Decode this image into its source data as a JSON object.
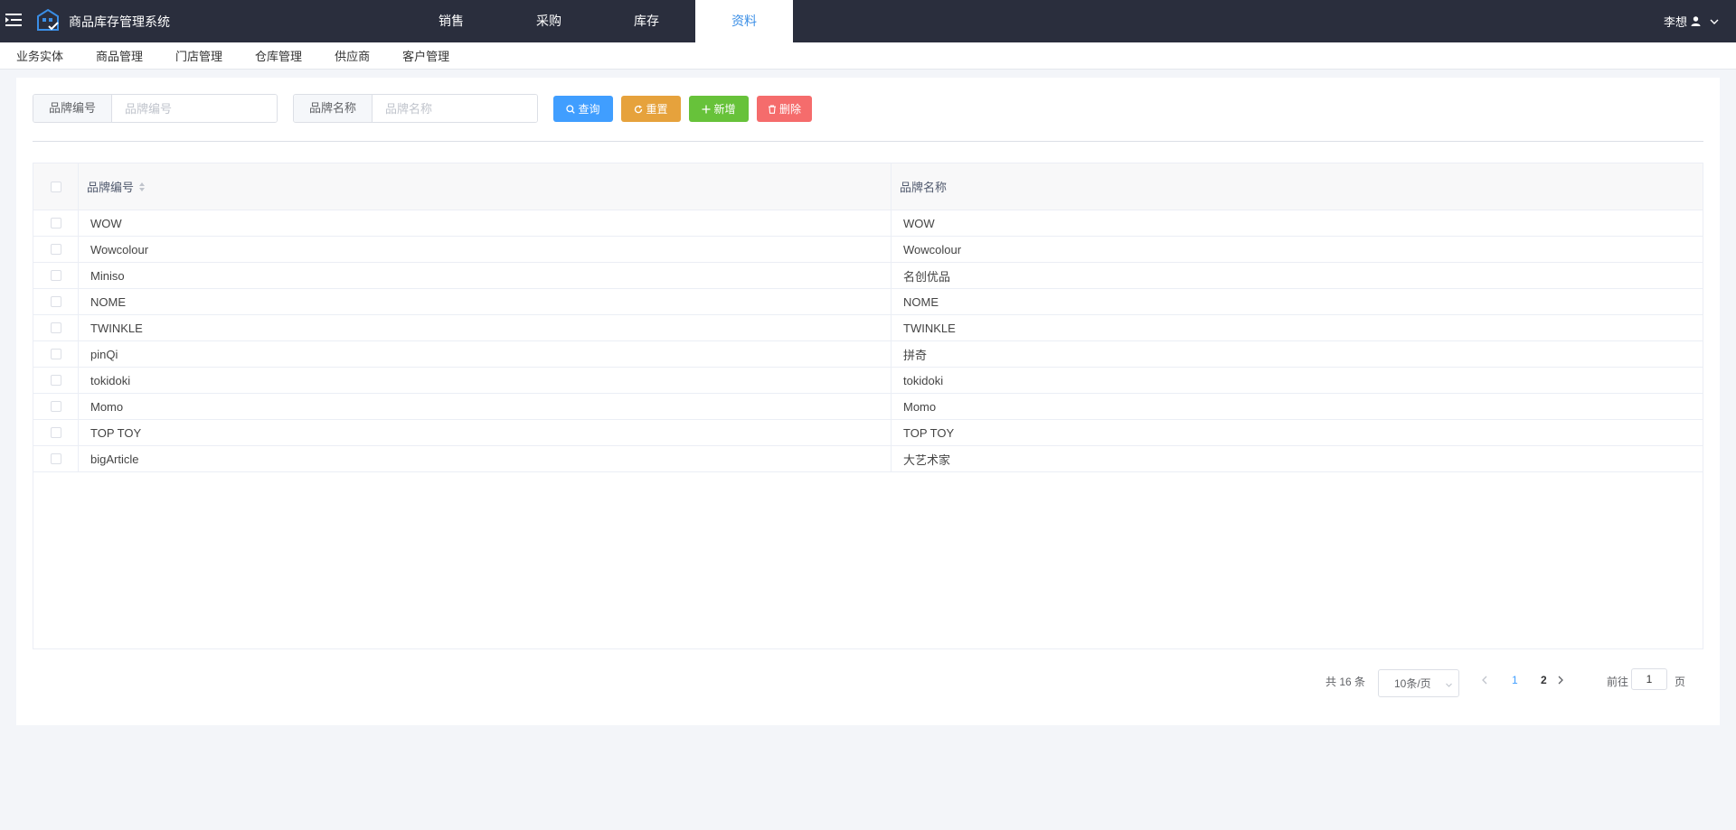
{
  "header": {
    "app_title": "商品库存管理系统",
    "tabs": [
      {
        "label": "销售",
        "active": false
      },
      {
        "label": "采购",
        "active": false
      },
      {
        "label": "库存",
        "active": false
      },
      {
        "label": "资料",
        "active": true
      }
    ],
    "user_name": "李想",
    "colors": {
      "bar": "#2a2e3d",
      "accent": "#3a8ee6"
    }
  },
  "subnav": {
    "items": [
      "业务实体",
      "商品管理",
      "门店管理",
      "仓库管理",
      "供应商",
      "客户管理"
    ]
  },
  "search": {
    "brand_code_label": "品牌编号",
    "brand_code_placeholder": "品牌编号",
    "brand_code_value": "",
    "brand_name_label": "品牌名称",
    "brand_name_placeholder": "品牌名称",
    "brand_name_value": ""
  },
  "buttons": {
    "query": "查询",
    "reset": "重置",
    "add": "新增",
    "delete": "删除"
  },
  "table": {
    "columns": [
      "品牌编号",
      "品牌名称"
    ],
    "rows": [
      {
        "code": "WOW",
        "name": "WOW"
      },
      {
        "code": "Wowcolour",
        "name": "Wowcolour"
      },
      {
        "code": "Miniso",
        "name": "名创优品"
      },
      {
        "code": "NOME",
        "name": "NOME"
      },
      {
        "code": "TWINKLE",
        "name": "TWINKLE"
      },
      {
        "code": "pinQi",
        "name": "拼奇"
      },
      {
        "code": "tokidoki",
        "name": "tokidoki"
      },
      {
        "code": "Momo",
        "name": "Momo"
      },
      {
        "code": "TOP TOY",
        "name": "TOP TOY"
      },
      {
        "code": "bigArticle",
        "name": "大艺术家"
      }
    ]
  },
  "pagination": {
    "total_text": "共 16 条",
    "page_size": "10条/页",
    "pages": [
      "1",
      "2"
    ],
    "current_page": "1",
    "goto_label": "前往",
    "goto_value": "1",
    "goto_suffix": "页"
  }
}
